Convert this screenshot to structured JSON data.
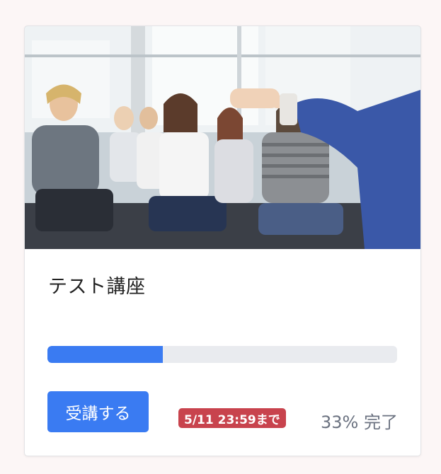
{
  "course": {
    "title": "テスト講座",
    "thumbnail_alt": "seminar-audience-photo",
    "progress_percent": 33,
    "progress_label": "33% 完了",
    "deadline_badge": "5/11 23:59まで",
    "enroll_label": "受講する"
  },
  "colors": {
    "accent": "#3a7bf2",
    "badge": "#c8434d",
    "track": "#e9ebef"
  }
}
